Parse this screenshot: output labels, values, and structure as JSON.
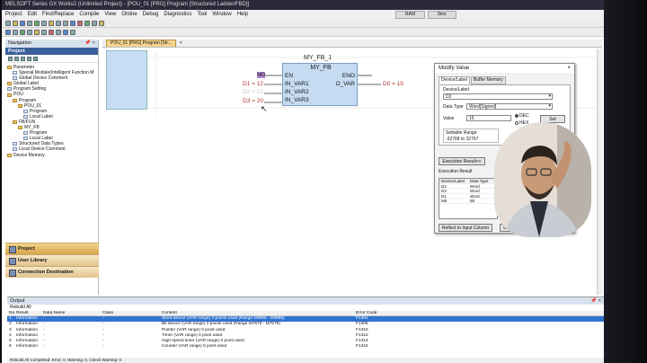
{
  "window": {
    "title": "MELSOFT Series GX Works2 (Unlimited Project) - [POU_01 [PRG] Program [Structured Ladder/FBD]]"
  },
  "menu": [
    "Project",
    "Edit",
    "Find/Replace",
    "Compile",
    "View",
    "Online",
    "Debug",
    "Diagnostics",
    "Tool",
    "Window",
    "Help"
  ],
  "memstat": {
    "ram": "RAM",
    "cycle": "8ms"
  },
  "navigation": {
    "title": "Navigation",
    "section": "Project",
    "tree": [
      {
        "label": "Parameter",
        "indent": 0,
        "icon": "folder"
      },
      {
        "label": "Special Module(Intelligent Function M",
        "indent": 1,
        "icon": "doc"
      },
      {
        "label": "Global Device Comment",
        "indent": 1,
        "icon": "doc"
      },
      {
        "label": "Global Label",
        "indent": 0,
        "icon": "folder"
      },
      {
        "label": "Program Setting",
        "indent": 0,
        "icon": "doc"
      },
      {
        "label": "POU",
        "indent": 0,
        "icon": "folder"
      },
      {
        "label": "Program",
        "indent": 1,
        "icon": "folder"
      },
      {
        "label": "POU_01",
        "indent": 2,
        "icon": "folder"
      },
      {
        "label": "Program",
        "indent": 3,
        "icon": "doc"
      },
      {
        "label": "Local Label",
        "indent": 3,
        "icon": "doc"
      },
      {
        "label": "FB/FUN",
        "indent": 1,
        "icon": "folder"
      },
      {
        "label": "MY_FB",
        "indent": 2,
        "icon": "folder"
      },
      {
        "label": "Program",
        "indent": 3,
        "icon": "doc"
      },
      {
        "label": "Local Label",
        "indent": 3,
        "icon": "doc"
      },
      {
        "label": "Structured Data Types",
        "indent": 1,
        "icon": "doc"
      },
      {
        "label": "Local Device Comment",
        "indent": 1,
        "icon": "doc"
      },
      {
        "label": "Device Memory",
        "indent": 0,
        "icon": "folder"
      }
    ],
    "buttons": [
      "Project",
      "User Library",
      "Connection Destination"
    ]
  },
  "editor": {
    "tab": "POU_01 [PRG] Program [Str...",
    "fb_instance": "MY_FB_1",
    "fb_type": "MY_FB",
    "pins_left": [
      "EN",
      "IN_VAR1",
      "IN_VAR2",
      "IN_VAR3"
    ],
    "pins_right": [
      "ENO",
      "O_VAR"
    ],
    "inputs": [
      "M0",
      "D1 = 12",
      "D2 = 15",
      "D3 = 20"
    ],
    "output": "D0 = 15"
  },
  "modify_value": {
    "title": "Modify Value",
    "tabs": [
      "Device/Label",
      "Buffer Memory"
    ],
    "device_label_caption": "Device/Label",
    "device_label_value": "D2",
    "data_type_caption": "Data Type",
    "data_type_value": "Word[Signed]",
    "value_caption": "Value",
    "value": "15",
    "radix_dec": "DEC",
    "radix_hex": "HEX",
    "set_button": "Set",
    "range_caption": "Settable Range",
    "range_value": "-32768 to 32767",
    "exec_button": "Execution Result<<",
    "exec_caption": "Execution Result",
    "table_headers": [
      "Device/Label",
      "Data Type"
    ],
    "table_rows": [
      [
        "D2",
        "Word"
      ],
      [
        "D3",
        "Word"
      ],
      [
        "D1",
        "Word"
      ],
      [
        "M0",
        "Bit"
      ]
    ],
    "reflect_button": "Reflect to Input Column",
    "delete_button": "Delete(D)"
  },
  "output_panel": {
    "title": "Output",
    "subtitle": "Rebuild All",
    "headers": [
      "No.",
      "Result",
      "Data Name",
      "Class",
      "Content",
      "Error Code"
    ],
    "rows": [
      [
        "1",
        "Information",
        "-",
        "-",
        "Word device (VAR range) 3 points used (Range D9995 - D9999)",
        "F1301"
      ],
      [
        "2",
        "Information",
        "-",
        "-",
        "Bit device (VAR range) 2 points used (Range M7678 - M7679)",
        "F1305"
      ],
      [
        "3",
        "Information",
        "-",
        "-",
        "Pointer (VAR range) 0 point used",
        "F1310"
      ],
      [
        "4",
        "Information",
        "-",
        "-",
        "Timer (VAR range) 0 point used",
        "F1312"
      ],
      [
        "5",
        "Information",
        "-",
        "-",
        "High-speed timer (VAR range) 0 point used",
        "F1314"
      ],
      [
        "6",
        "Information",
        "-",
        "-",
        "Counter (VAR range) 0 point used",
        "F1316"
      ]
    ],
    "status": "Rebuild All Completed: Error: 0, Warning: 0, Check Warning: 0"
  }
}
